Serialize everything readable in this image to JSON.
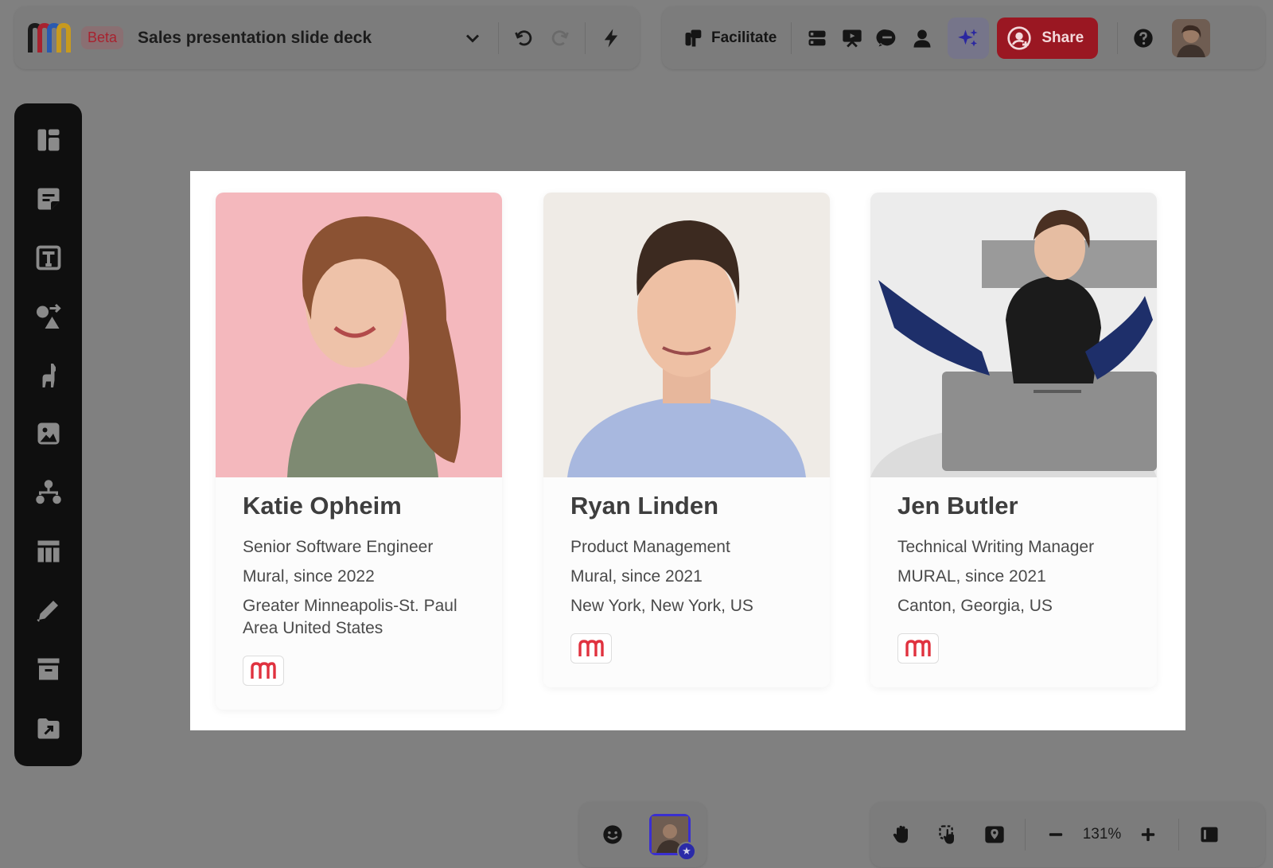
{
  "app": {
    "beta_label": "Beta",
    "title": "Sales presentation slide deck"
  },
  "toolbar_right": {
    "facilitate_label": "Facilitate",
    "share_label": "Share"
  },
  "sidebar": {
    "items": [
      "templates",
      "sticky-note",
      "text",
      "shapes",
      "icons",
      "image",
      "diagram",
      "table",
      "draw",
      "outline",
      "export"
    ]
  },
  "cards": [
    {
      "name": "Katie Opheim",
      "role": "Senior Software Engineer",
      "company": "Mural, since 2022",
      "location": "Greater Minneapolis-St. Paul Area United States"
    },
    {
      "name": "Ryan Linden",
      "role": "Product Management",
      "company": "Mural, since 2021",
      "location": "New York, New York, US"
    },
    {
      "name": "Jen Butler",
      "role": "Technical Writing Manager",
      "company": "MURAL, since 2021",
      "location": "Canton, Georgia, US"
    }
  ],
  "bottom": {
    "zoom": "131%"
  },
  "colors": {
    "accent": "#9a1722",
    "canvas": "#808080",
    "sidebar": "#0f0f0f"
  }
}
